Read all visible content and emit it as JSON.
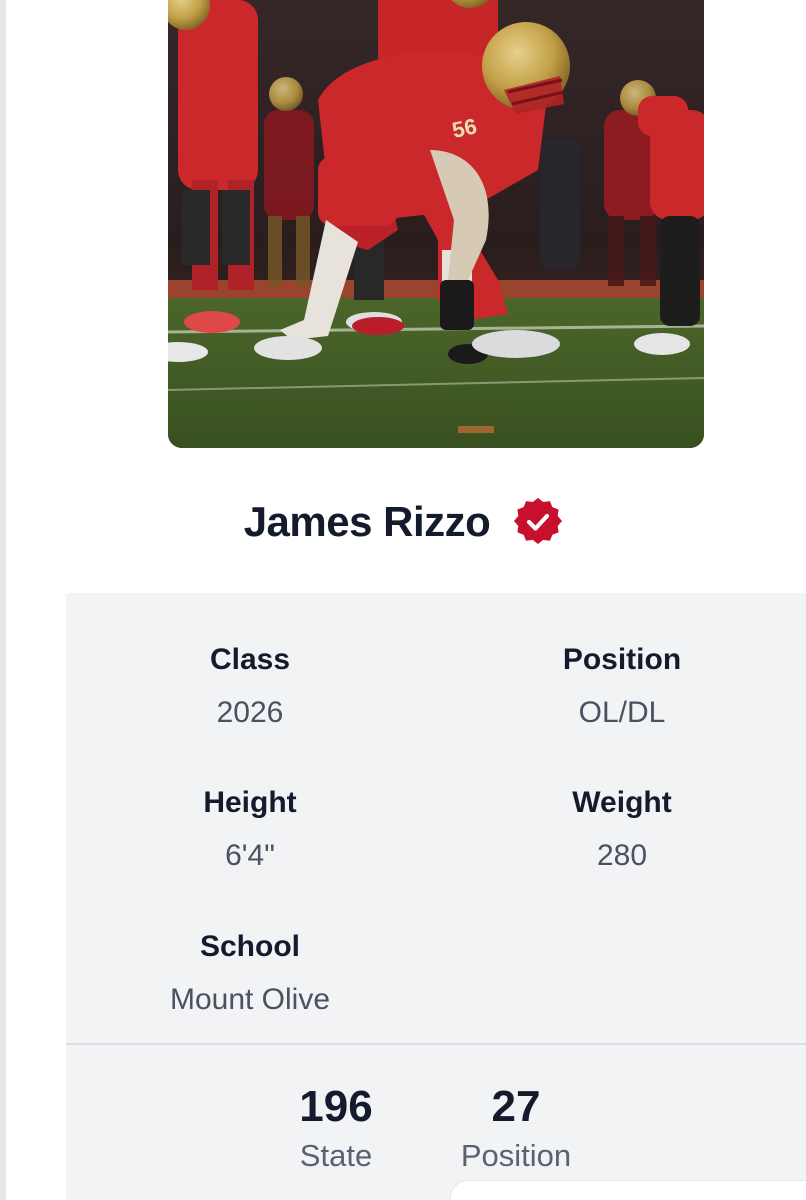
{
  "player": {
    "name": "James Rizzo",
    "verified_icon": "verified-badge-icon",
    "photo_jersey_number": "56"
  },
  "colors": {
    "name_text": "#141b2d",
    "verified_badge": "#c8102e",
    "panel_bg": "#f2f3f5"
  },
  "info": {
    "class": {
      "label": "Class",
      "value": "2026"
    },
    "position": {
      "label": "Position",
      "value": "OL/DL"
    },
    "height": {
      "label": "Height",
      "value": "6'4\""
    },
    "weight": {
      "label": "Weight",
      "value": "280"
    },
    "school": {
      "label": "School",
      "value": "Mount Olive"
    }
  },
  "rankings": {
    "state": {
      "value": "196",
      "label": "State"
    },
    "position": {
      "value": "27",
      "label": "Position"
    }
  }
}
